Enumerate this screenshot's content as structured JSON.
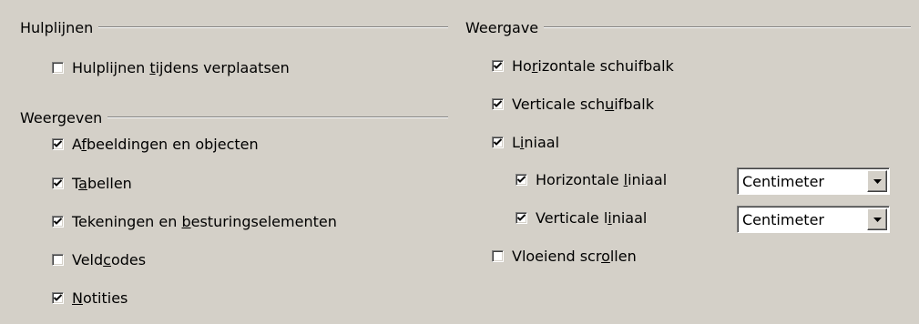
{
  "hulplijnen": {
    "title": "Hulplijnen",
    "items": [
      {
        "label_pre": "Hulplijnen ",
        "label_u": "t",
        "label_post": "ijdens verplaatsen",
        "checked": false
      }
    ]
  },
  "weergeven": {
    "title": "Weergeven",
    "items": [
      {
        "label_pre": "A",
        "label_u": "f",
        "label_post": "beeldingen en objecten",
        "checked": true
      },
      {
        "label_pre": "T",
        "label_u": "a",
        "label_post": "bellen",
        "checked": true
      },
      {
        "label_pre": "Tekeningen en ",
        "label_u": "b",
        "label_post": "esturingselementen",
        "checked": true
      },
      {
        "label_pre": "Veld",
        "label_u": "c",
        "label_post": "odes",
        "checked": false
      },
      {
        "label_pre": "",
        "label_u": "N",
        "label_post": "otities",
        "checked": true
      }
    ]
  },
  "weergave": {
    "title": "Weergave",
    "items": [
      {
        "label_pre": "Ho",
        "label_u": "r",
        "label_post": "izontale schuifbalk",
        "checked": true
      },
      {
        "label_pre": "Verticale sch",
        "label_u": "u",
        "label_post": "ifbalk",
        "checked": true
      },
      {
        "label_pre": "L",
        "label_u": "i",
        "label_post": "niaal",
        "checked": true
      },
      {
        "label_pre": "Horizontale ",
        "label_u": "l",
        "label_post": "iniaal",
        "checked": true,
        "unit": "Centimeter"
      },
      {
        "label_pre": "Verticale l",
        "label_u": "i",
        "label_post": "niaal",
        "checked": true,
        "unit": "Centimeter"
      },
      {
        "label_pre": "Vloeiend scr",
        "label_u": "o",
        "label_post": "llen",
        "checked": false
      }
    ]
  }
}
